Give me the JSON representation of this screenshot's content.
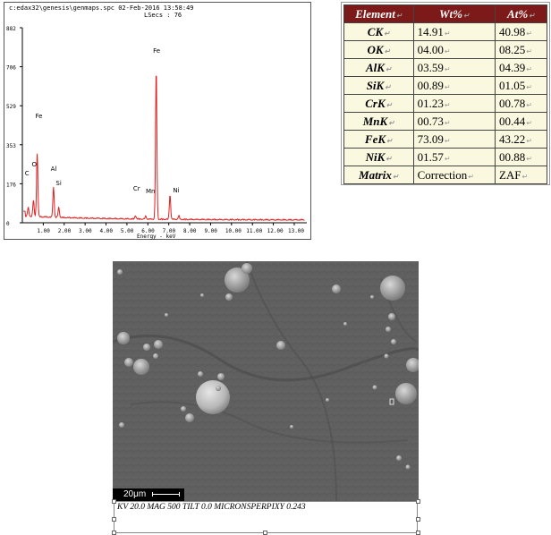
{
  "spectrum": {
    "header_line1": "c:edax32\\genesis\\genmaps.spc  02-Feb-2016 13:58:49",
    "header_line2": "LSecs : 76",
    "y_ticks": [
      "882",
      "706",
      "529",
      "353",
      "176",
      "0"
    ],
    "x_ticks": [
      "1.00",
      "2.00",
      "3.00",
      "4.00",
      "5.00",
      "6.00",
      "7.00",
      "8.00",
      "9.00",
      "10.00",
      "11.00",
      "12.00",
      "13.00"
    ],
    "x_label": "Energy - keV",
    "peak_labels": [
      "C",
      "O",
      "Fe",
      "Al",
      "Si",
      "Cr",
      "Mn",
      "Fe",
      "Ni"
    ],
    "line_color": "#e02020"
  },
  "table": {
    "headers": [
      "Element",
      "Wt%",
      "At%"
    ],
    "rows": [
      {
        "element": "CK",
        "wt": "14.91",
        "at": "40.98"
      },
      {
        "element": "OK",
        "wt": "04.00",
        "at": "08.25"
      },
      {
        "element": "AlK",
        "wt": "03.59",
        "at": "04.39"
      },
      {
        "element": "SiK",
        "wt": "00.89",
        "at": "01.05"
      },
      {
        "element": "CrK",
        "wt": "01.23",
        "at": "00.78"
      },
      {
        "element": "MnK",
        "wt": "00.73",
        "at": "00.44"
      },
      {
        "element": "FeK",
        "wt": "73.09",
        "at": "43.22"
      },
      {
        "element": "NiK",
        "wt": "01.57",
        "at": "00.88"
      },
      {
        "element": "Matrix",
        "wt": "Correction",
        "at": "ZAF"
      }
    ],
    "header_color": "#7b1a18",
    "cell_color": "#fbf8e0"
  },
  "sem": {
    "scale_label": "20μm",
    "caption": "KV  20.0   MAG  500   TILT  0.0   MICRONSPERPIXY 0.243"
  }
}
